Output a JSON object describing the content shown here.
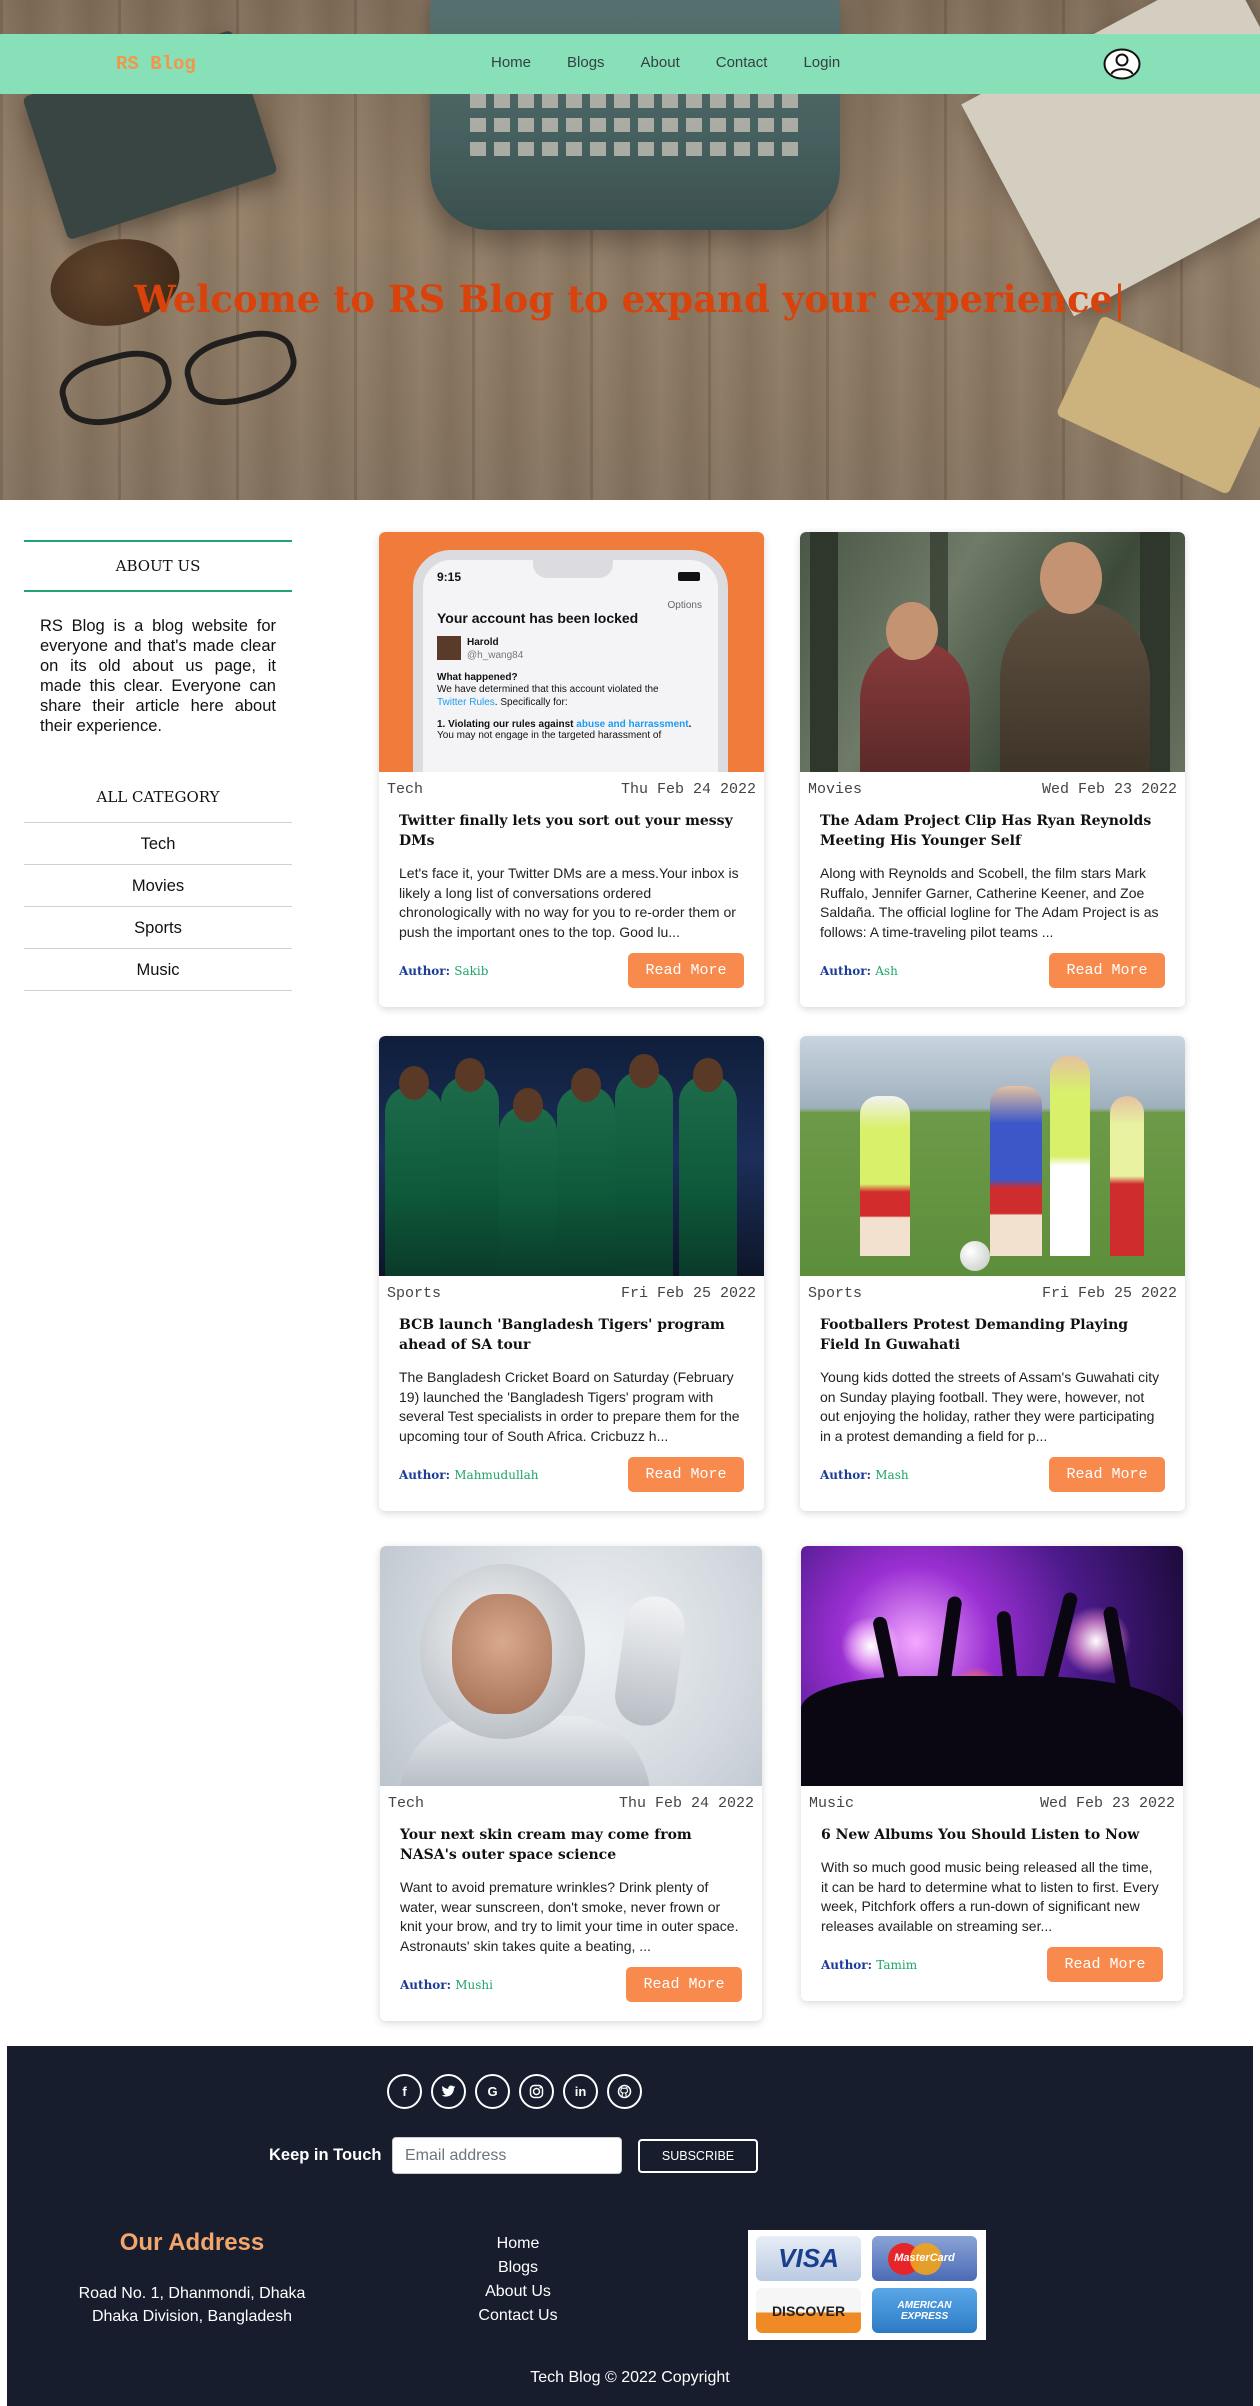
{
  "navbar": {
    "brand": "RS Blog",
    "links": [
      "Home",
      "Blogs",
      "About",
      "Contact",
      "Login"
    ],
    "user_icon": "user-circle-icon"
  },
  "hero": {
    "title": "Welcome to RS Blog to expand your experience",
    "caret": "|"
  },
  "sidebar": {
    "about_heading": "ABOUT US",
    "about_text": "RS Blog is a blog website for everyone and that's made clear on its old about us page, it made this clear. Everyone can share their article here about their experience.",
    "category_heading": "ALL CATEGORY",
    "categories": [
      "Tech",
      "Movies",
      "Sports",
      "Music"
    ]
  },
  "posts": [
    {
      "category": "Tech",
      "date": "Thu Feb 24 2022",
      "title": "Twitter finally lets you sort out your messy DMs",
      "excerpt": "Let's face it, your Twitter DMs are a mess.Your inbox is likely a long list of conversations ordered chronologically with no way for you to re-order them or push the important ones to the top. Good lu...",
      "author_label": "Author:",
      "author": "Sakib",
      "button": "Read More",
      "image_text": {
        "time": "9:15",
        "options": "Options",
        "heading": "Your account has been locked",
        "name": "Harold",
        "handle": "@h_wang84",
        "q": "What happened?",
        "body": "We have determined that this account violated the",
        "rules_link": "Twitter Rules",
        "specifically": ". Specifically for:",
        "violation_prefix": "1. Violating our rules against ",
        "violation_link": "abuse and harrassment",
        "violation_end": ".",
        "last": "You may not engage in the targeted harassment of"
      }
    },
    {
      "category": "Movies",
      "date": "Wed Feb 23 2022",
      "title": "The Adam Project Clip Has Ryan Reynolds Meeting His Younger Self",
      "excerpt": "Along with Reynolds and Scobell, the film stars Mark Ruffalo, Jennifer Garner, Catherine Keener, and Zoe Saldaña. The official logline for The Adam Project is as follows: A time-traveling pilot teams ...",
      "author_label": "Author:",
      "author": "Ash",
      "button": "Read More"
    },
    {
      "category": "Sports",
      "date": "Fri Feb 25 2022",
      "title": "BCB launch 'Bangladesh Tigers' program ahead of SA tour",
      "excerpt": "The Bangladesh Cricket Board on Saturday (February 19) launched the 'Bangladesh Tigers' program with several Test specialists in order to prepare them for the upcoming tour of South Africa. Cricbuzz h...",
      "author_label": "Author:",
      "author": "Mahmudullah",
      "button": "Read More"
    },
    {
      "category": "Sports",
      "date": "Fri Feb 25 2022",
      "title": "Footballers Protest Demanding Playing Field In Guwahati",
      "excerpt": "Young kids dotted the streets of Assam's Guwahati city on Sunday playing football. They were, however, not out enjoying the holiday, rather they were participating in a protest demanding a field for p...",
      "author_label": "Author:",
      "author": "Mash",
      "button": "Read More"
    },
    {
      "category": "Tech",
      "date": "Thu Feb 24 2022",
      "title": "Your next skin cream may come from NASA's outer space science",
      "excerpt": "Want to avoid premature wrinkles? Drink plenty of water, wear sunscreen, don't smoke, never frown or knit your brow, and try to limit your time in outer space. Astronauts' skin takes quite a beating, ...",
      "author_label": "Author:",
      "author": "Mushi",
      "button": "Read More"
    },
    {
      "category": "Music",
      "date": "Wed Feb 23 2022",
      "title": "6 New Albums You Should Listen to Now",
      "excerpt": "With so much good music being released all the time, it can be hard to determine what to listen to first. Every week, Pitchfork offers a run-down of significant new releases available on streaming ser...",
      "author_label": "Author:",
      "author": "Tamim",
      "button": "Read More"
    }
  ],
  "footer": {
    "social_icons": [
      "facebook-icon",
      "twitter-icon",
      "google-icon",
      "instagram-icon",
      "linkedin-icon",
      "github-icon"
    ],
    "keep_in_touch": "Keep in Touch",
    "email_placeholder": "Email address",
    "subscribe": "SUBSCRIBE",
    "address_heading": "Our Address",
    "address_line1": "Road No. 1, Dhanmondi, Dhaka",
    "address_line2": "Dhaka Division, Bangladesh",
    "links": [
      "Home",
      "Blogs",
      "About Us",
      "Contact Us"
    ],
    "payment_cards": [
      "VISA",
      "MasterCard",
      "DISCOVER",
      "AMERICAN EXPRESS"
    ],
    "copyright": "Tech Blog © 2022 Copyright"
  },
  "colors": {
    "navbar_bg": "#87e0b8",
    "brand": "#f0974b",
    "hero_title": "#d9420b",
    "accent_green": "#22a36f",
    "button": "#f88a4d",
    "footer_bg": "#171d2d",
    "address_heading": "#f2a66c"
  }
}
